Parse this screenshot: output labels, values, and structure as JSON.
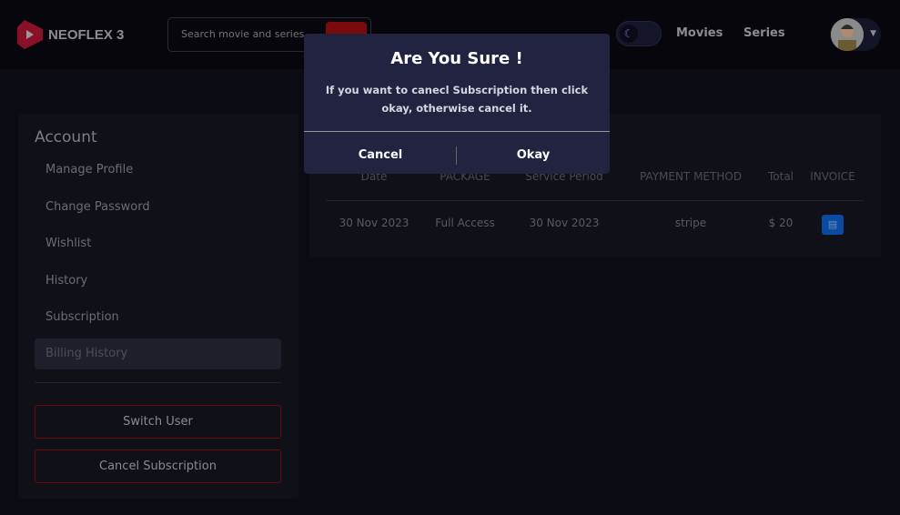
{
  "header": {
    "logo": "NEOFLEX 3",
    "search_placeholder": "Search movie and series",
    "nav": [
      "Movies",
      "Series"
    ]
  },
  "sidebar": {
    "title": "Account",
    "items": [
      "Manage Profile",
      "Change Password",
      "Wishlist",
      "History",
      "Subscription",
      "Billing History"
    ],
    "active": "Billing History",
    "buttons": [
      "Switch User",
      "Cancel Subscription"
    ]
  },
  "billing": {
    "columns": [
      "Date",
      "PACKAGE",
      "Service Period",
      "PAYMENT METHOD",
      "Total",
      "INVOICE"
    ],
    "rows": [
      [
        "30 Nov 2023",
        "Full Access",
        "30 Nov 2023",
        "stripe",
        "$ 20"
      ]
    ]
  },
  "modal": {
    "title": "Are You Sure !",
    "message": "If you want to canecl Subscription then click okay, otherwise cancel it.",
    "cancel": "Cancel",
    "okay": "Okay"
  },
  "colors": {
    "accent": "#7a0a0c",
    "modal_bg": "#222341",
    "invoice": "#0a4aa0"
  }
}
